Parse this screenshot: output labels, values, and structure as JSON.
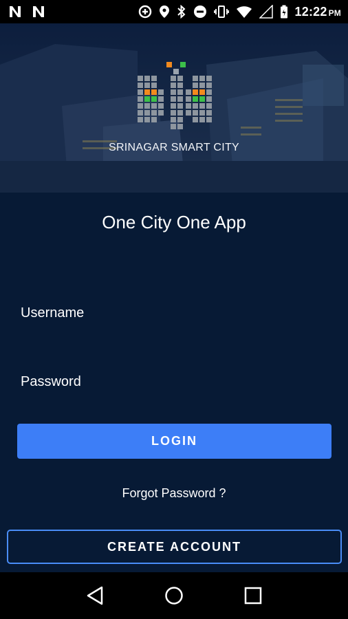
{
  "status_bar": {
    "time": "12:22",
    "ampm": "PM",
    "left_icons": [
      "n-notification-icon",
      "n-notification-icon"
    ],
    "right_icons": [
      "data-saver-icon",
      "location-icon",
      "bluetooth-icon",
      "do-not-disturb-icon",
      "vibrate-icon",
      "wifi-icon",
      "signal-icon",
      "battery-icon"
    ]
  },
  "banner": {
    "brand_name": "SRINAGAR SMART CITY"
  },
  "app": {
    "title": "One City One App"
  },
  "form": {
    "username_placeholder": "Username",
    "password_placeholder": "Password",
    "login_label": "LOGIN",
    "forgot_label": "Forgot Password ?",
    "create_account_label": "CREATE ACCOUNT"
  },
  "nav": {
    "icons": [
      "back-icon",
      "home-icon",
      "recents-icon"
    ]
  },
  "colors": {
    "background": "#071a35",
    "primary": "#3d7ef7",
    "outline": "#4a8df7",
    "logo_orange": "#f28a1e",
    "logo_green": "#3cbf4a"
  }
}
